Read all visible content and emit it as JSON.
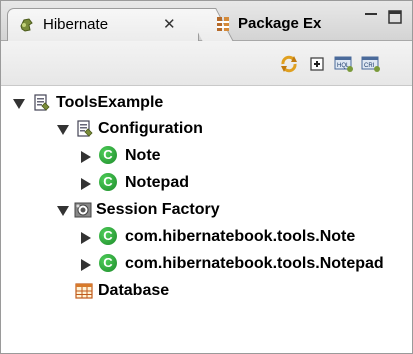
{
  "tabs": [
    {
      "label": "Hibernate",
      "active": true
    },
    {
      "label": "Package Ex",
      "active": false
    }
  ],
  "toolbar": {
    "icons": [
      "refresh-icon",
      "collapse-all-icon",
      "hql-editor-icon",
      "criteria-editor-icon"
    ]
  },
  "tree": {
    "root": {
      "label": "ToolsExample"
    },
    "configuration": {
      "label": "Configuration",
      "children": [
        "Note",
        "Notepad"
      ]
    },
    "session_factory": {
      "label": "Session Factory",
      "children": [
        "com.hibernatebook.tools.Note",
        "com.hibernatebook.tools.Notepad"
      ]
    },
    "database": {
      "label": "Database"
    }
  },
  "colors": {
    "class_icon": "#2ea33a",
    "tab_bg": "#ececec"
  }
}
